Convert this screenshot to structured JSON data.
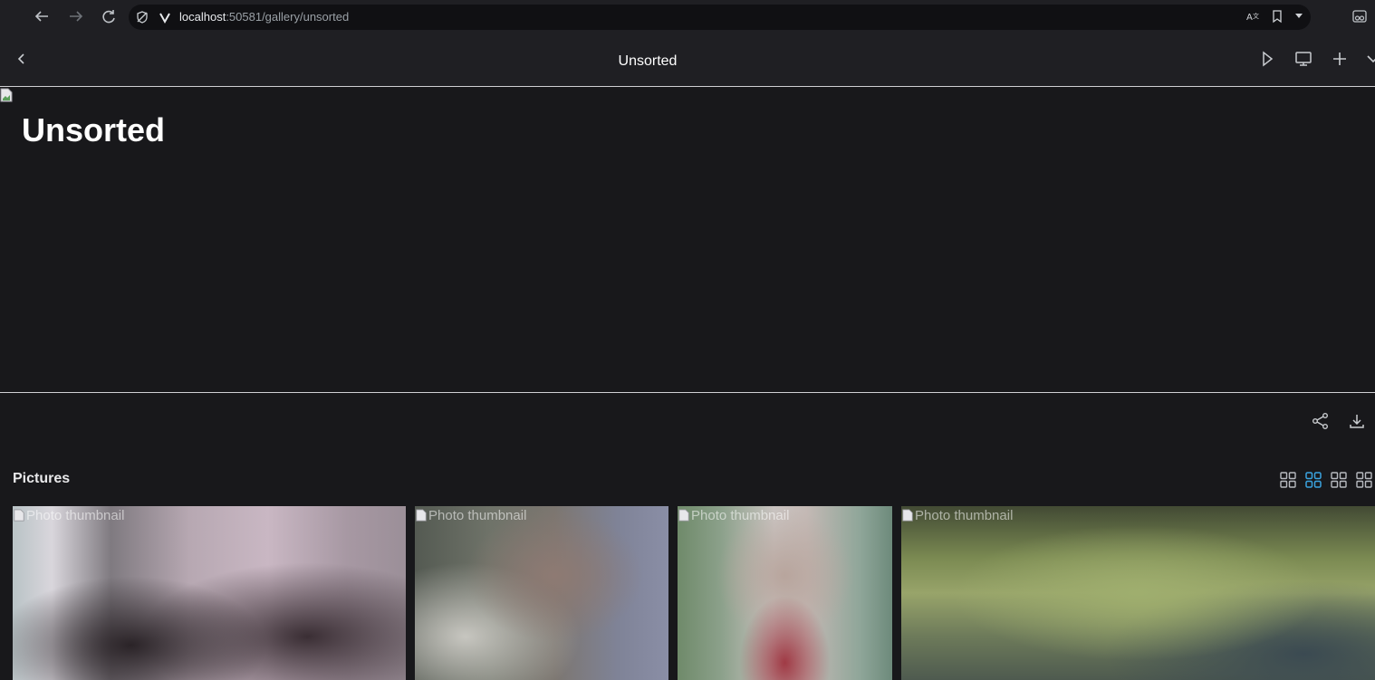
{
  "browser": {
    "url_host": "localhost",
    "url_rest": ":50581/gallery/unsorted"
  },
  "header": {
    "title": "Unsorted"
  },
  "hero": {
    "title": "Unsorted"
  },
  "section": {
    "title": "Pictures"
  },
  "thumbnails": [
    {
      "alt": "Photo thumbnail"
    },
    {
      "alt": "Photo thumbnail"
    },
    {
      "alt": "Photo thumbnail"
    },
    {
      "alt": "Photo thumbnail"
    }
  ],
  "colors": {
    "background": "#18181b",
    "header": "#1f1f23",
    "accent": "#3aa3e0"
  },
  "icons": [
    "back-arrow-icon",
    "forward-arrow-icon",
    "reload-icon",
    "shield-icon",
    "vivaldi-icon",
    "translate-icon",
    "bookmark-icon",
    "dropdown-icon",
    "extension-icon",
    "chevron-left-icon",
    "play-icon",
    "monitor-icon",
    "plus-icon",
    "chevron-down-icon",
    "share-icon",
    "download-icon",
    "grid-icon"
  ]
}
